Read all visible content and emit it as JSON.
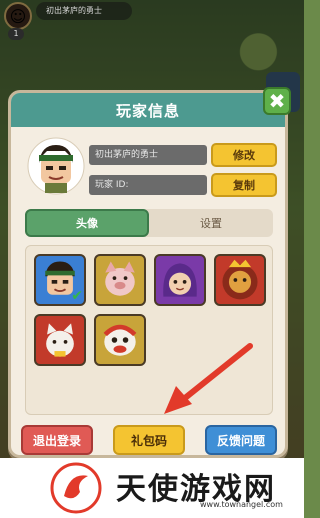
{
  "top_bar": {
    "player_name": "初出茅庐的勇士",
    "level": "1"
  },
  "modal": {
    "title": "玩家信息",
    "close_label": "✖",
    "name_field": "初出茅庐的勇士",
    "id_field": "玩家 ID:",
    "rename_label": "修改",
    "copy_label": "复制",
    "tabs": [
      {
        "label": "头像",
        "active": true
      },
      {
        "label": "设置",
        "active": false
      }
    ],
    "avatars": [
      {
        "name": "hero",
        "bg": "#3a7fd4",
        "selected": true
      },
      {
        "name": "pig-warrior",
        "bg": "#c8a43a",
        "selected": false
      },
      {
        "name": "purple-hood",
        "bg": "#7a3aa8",
        "selected": false
      },
      {
        "name": "lion-king",
        "bg": "#c23a2a",
        "selected": false
      },
      {
        "name": "fortune-cat",
        "bg": "#c23a2a",
        "selected": false
      },
      {
        "name": "lion-dance",
        "bg": "#c8a43a",
        "selected": false
      }
    ],
    "buttons": {
      "logout": "退出登录",
      "gift_code": "礼包码",
      "feedback": "反馈问题"
    }
  },
  "watermark": {
    "text": "天使游戏网",
    "url": "www.townangel.com"
  },
  "colors": {
    "header": "#4d9a90",
    "accent_yellow": "#f4c431",
    "logout_red": "#e05a55",
    "feedback_blue": "#3f8fd6"
  }
}
